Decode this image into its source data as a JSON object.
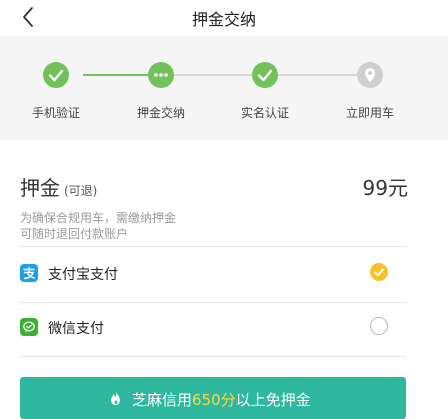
{
  "nav": {
    "title": "押金交纳"
  },
  "steps": [
    {
      "label": "手机验证",
      "state": "done"
    },
    {
      "label": "押金交纳",
      "state": "current"
    },
    {
      "label": "实名认证",
      "state": "done"
    },
    {
      "label": "立即用车",
      "state": "pending"
    }
  ],
  "deposit": {
    "label": "押金",
    "note": "(可退)",
    "amount": "99元"
  },
  "description": {
    "line1": "为确保合规用车，需缴纳押金",
    "line2": "可随时退回付款账户"
  },
  "payment": {
    "alipay": {
      "label": "支付宝支付",
      "selected": true
    },
    "wechat": {
      "label": "微信支付",
      "selected": false
    }
  },
  "cta": {
    "prefix": "芝麻信用",
    "score": "650分",
    "suffix": "以上免押金"
  },
  "colors": {
    "green": "#72c15a",
    "teal": "#2eb89f",
    "yellow": "#f8c12c",
    "alipay": "#1e9fe6",
    "wechat": "#3cb035"
  }
}
